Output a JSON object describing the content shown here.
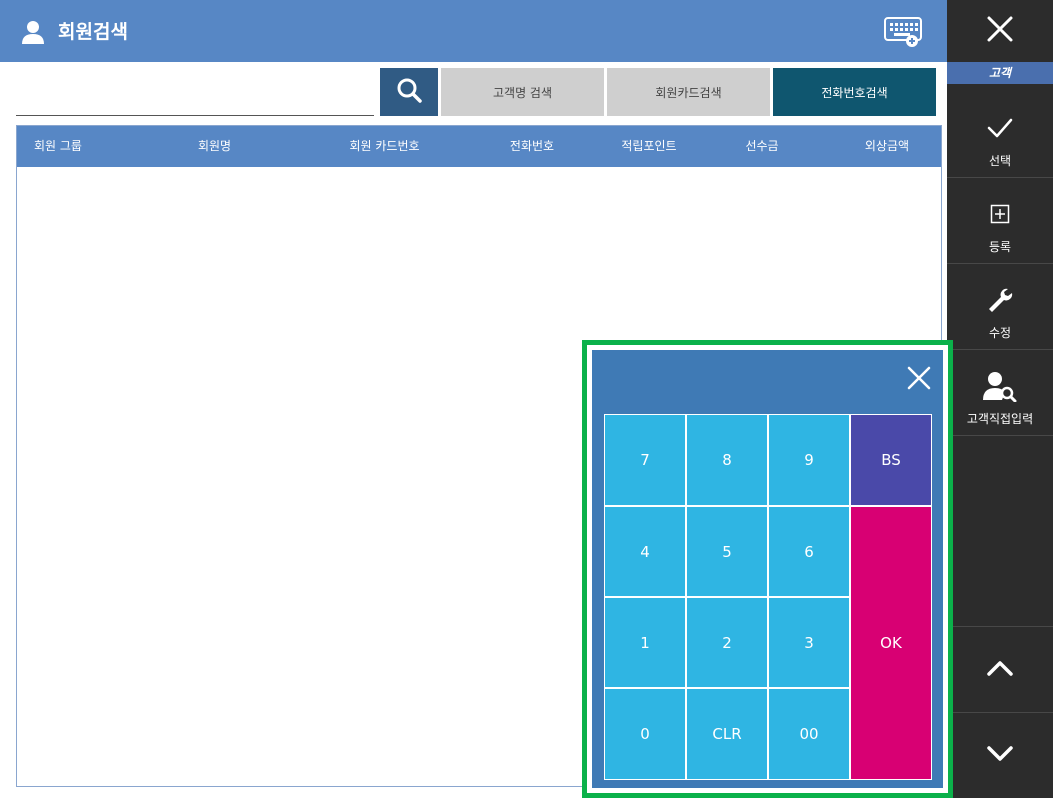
{
  "header": {
    "title": "회원검색",
    "user_icon": "user-icon",
    "keyboard_icon": "keyboard-icon"
  },
  "sidebar": {
    "close_icon": "close-icon",
    "section_label": "고객",
    "buttons": [
      {
        "label": "선택",
        "icon": "check-icon"
      },
      {
        "label": "등록",
        "icon": "plus-box-icon"
      },
      {
        "label": "수정",
        "icon": "wrench-icon"
      },
      {
        "label": "고객직접입력",
        "icon": "user-search-icon"
      }
    ],
    "up_icon": "chevron-up-icon",
    "down_icon": "chevron-down-icon"
  },
  "search": {
    "value": "",
    "placeholder": "",
    "search_icon": "search-icon",
    "tabs": [
      {
        "label": "고객명 검색",
        "active": false
      },
      {
        "label": "회원카드검색",
        "active": false
      },
      {
        "label": "전화번호검색",
        "active": true
      }
    ]
  },
  "table": {
    "columns": [
      "회원 그룹",
      "회원명",
      "회원 카드번호",
      "전화번호",
      "적립포인트",
      "선수금",
      "외상금액"
    ],
    "rows": []
  },
  "numpad": {
    "close_icon": "close-icon",
    "keys": {
      "k7": "7",
      "k8": "8",
      "k9": "9",
      "bs": "BS",
      "k4": "4",
      "k5": "5",
      "k6": "6",
      "k1": "1",
      "k2": "2",
      "k3": "3",
      "ok": "OK",
      "k0": "0",
      "clr": "CLR",
      "k00": "00"
    }
  },
  "colors": {
    "header_blue": "#5787c5",
    "sidebar_dark": "#2c2c2c",
    "active_tab": "#0f566f",
    "key_blue": "#2fb5e3",
    "key_bs": "#4a49a9",
    "key_ok": "#d80073",
    "numpad_frame": "#0bb14a"
  }
}
